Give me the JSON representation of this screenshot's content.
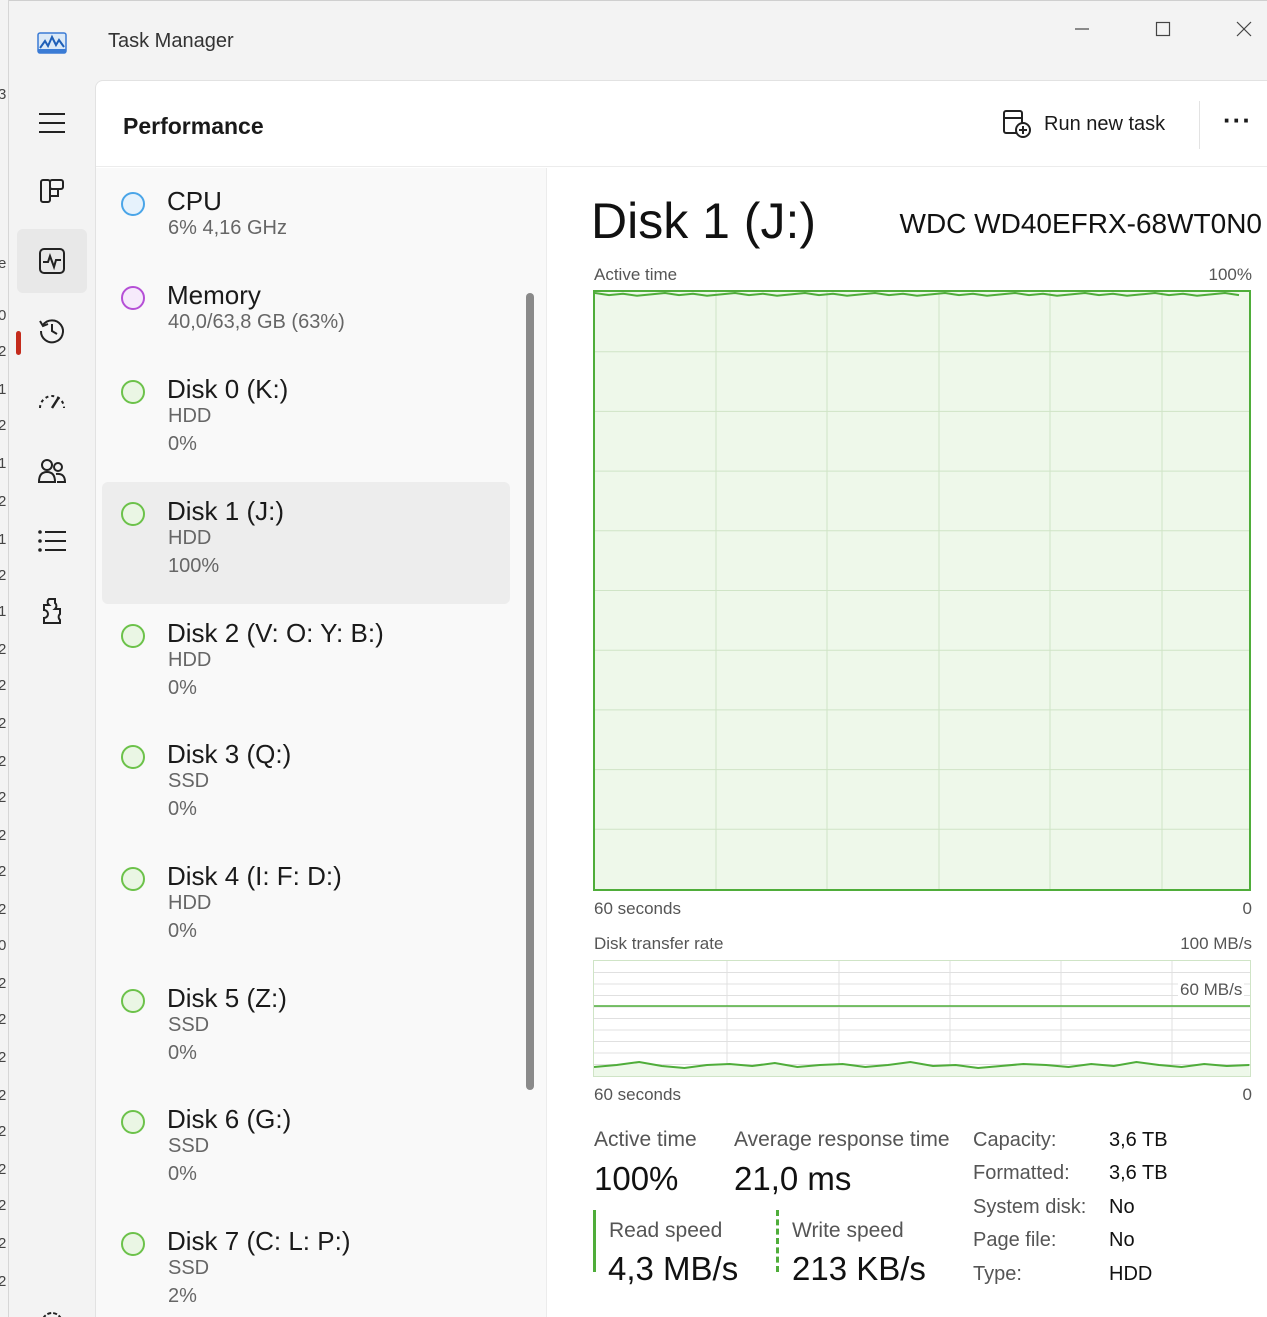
{
  "window": {
    "title": "Task Manager"
  },
  "header": {
    "page_title": "Performance",
    "run_new_task": "Run new task",
    "more": "···"
  },
  "nav": [
    {
      "icon": "hamburger-icon"
    },
    {
      "icon": "processes-icon"
    },
    {
      "icon": "performance-icon",
      "active": true
    },
    {
      "icon": "app-history-icon"
    },
    {
      "icon": "startup-apps-icon"
    },
    {
      "icon": "users-icon"
    },
    {
      "icon": "details-icon"
    },
    {
      "icon": "services-icon"
    },
    {
      "icon": "settings-icon"
    }
  ],
  "devices": [
    {
      "name": "CPU",
      "line1": "6%  4,16 GHz",
      "color": "#4aa5e8"
    },
    {
      "name": "Memory",
      "line1": "40,0/63,8 GB (63%)",
      "color": "#b54fd6"
    },
    {
      "name": "Disk 0 (K:)",
      "line1": "HDD",
      "line2": "0%",
      "color": "#6cc24a"
    },
    {
      "name": "Disk 1 (J:)",
      "line1": "HDD",
      "line2": "100%",
      "color": "#6cc24a",
      "selected": true
    },
    {
      "name": "Disk 2 (V: O: Y: B:)",
      "line1": "HDD",
      "line2": "0%",
      "color": "#6cc24a"
    },
    {
      "name": "Disk 3 (Q:)",
      "line1": "SSD",
      "line2": "0%",
      "color": "#6cc24a"
    },
    {
      "name": "Disk 4 (I: F: D:)",
      "line1": "HDD",
      "line2": "0%",
      "color": "#6cc24a"
    },
    {
      "name": "Disk 5 (Z:)",
      "line1": "SSD",
      "line2": "0%",
      "color": "#6cc24a"
    },
    {
      "name": "Disk 6 (G:)",
      "line1": "SSD",
      "line2": "0%",
      "color": "#6cc24a"
    },
    {
      "name": "Disk 7 (C: L: P:)",
      "line1": "SSD",
      "line2": "2%",
      "color": "#6cc24a"
    }
  ],
  "detail": {
    "title": "Disk 1 (J:)",
    "model": "WDC WD40EFRX-68WT0N0",
    "active_graph": {
      "label": "Active time",
      "max_label": "100%",
      "x_left": "60 seconds",
      "x_right": "0"
    },
    "transfer_graph": {
      "label": "Disk transfer rate",
      "max_label": "100 MB/s",
      "mid_label": "60 MB/s",
      "x_left": "60 seconds",
      "x_right": "0"
    },
    "stats": {
      "active_time_label": "Active time",
      "active_time_value": "100%",
      "response_label": "Average response time",
      "response_value": "21,0 ms",
      "read_label": "Read speed",
      "read_value": "4,3 MB/s",
      "write_label": "Write speed",
      "write_value": "213 KB/s"
    },
    "props": [
      {
        "label": "Capacity:",
        "value": "3,6 TB"
      },
      {
        "label": "Formatted:",
        "value": "3,6 TB"
      },
      {
        "label": "System disk:",
        "value": "No"
      },
      {
        "label": "Page file:",
        "value": "No"
      },
      {
        "label": "Type:",
        "value": "HDD"
      }
    ]
  },
  "colors": {
    "accent_green": "#4fad3a",
    "graph_fill": "#eef8ea",
    "nav_indicator": "#c42b1c"
  }
}
